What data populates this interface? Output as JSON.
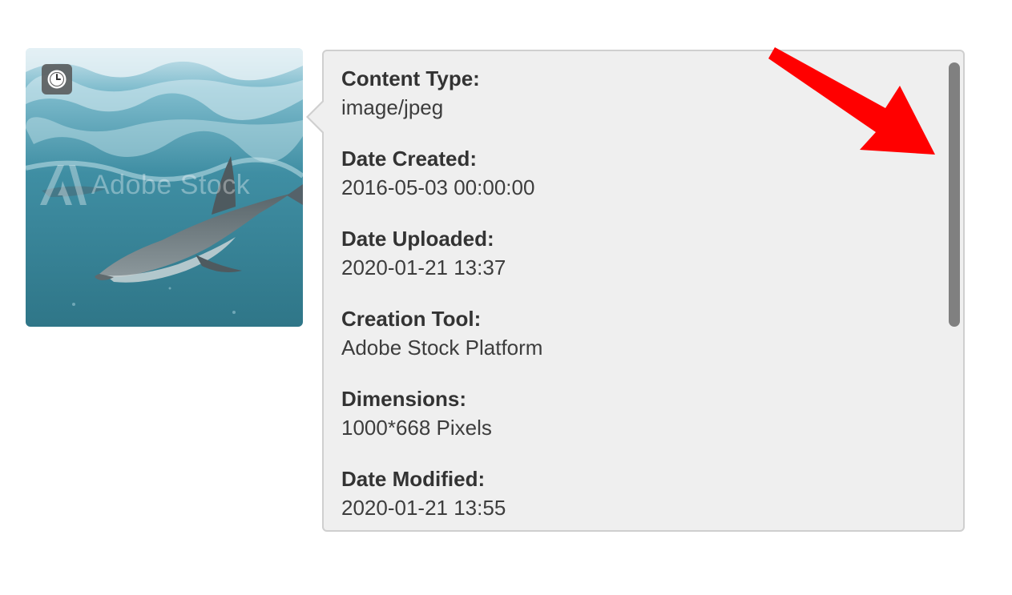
{
  "thumbnail": {
    "watermark_text": "Adobe Stock",
    "badge_icon": "clock-icon"
  },
  "info": {
    "fields": [
      {
        "label": "Content Type:",
        "value": "image/jpeg"
      },
      {
        "label": "Date Created:",
        "value": "2016-05-03 00:00:00"
      },
      {
        "label": "Date Uploaded:",
        "value": "2020-01-21 13:37"
      },
      {
        "label": "Creation Tool:",
        "value": "Adobe Stock Platform"
      },
      {
        "label": "Dimensions:",
        "value": "1000*668 Pixels"
      },
      {
        "label": "Date Modified:",
        "value": "2020-01-21 13:55"
      }
    ]
  },
  "colors": {
    "panel_bg": "#efefef",
    "panel_border": "#cfcfcf",
    "label_text": "#333333",
    "scrollbar": "#808080",
    "annotation_arrow": "#ff0000"
  }
}
